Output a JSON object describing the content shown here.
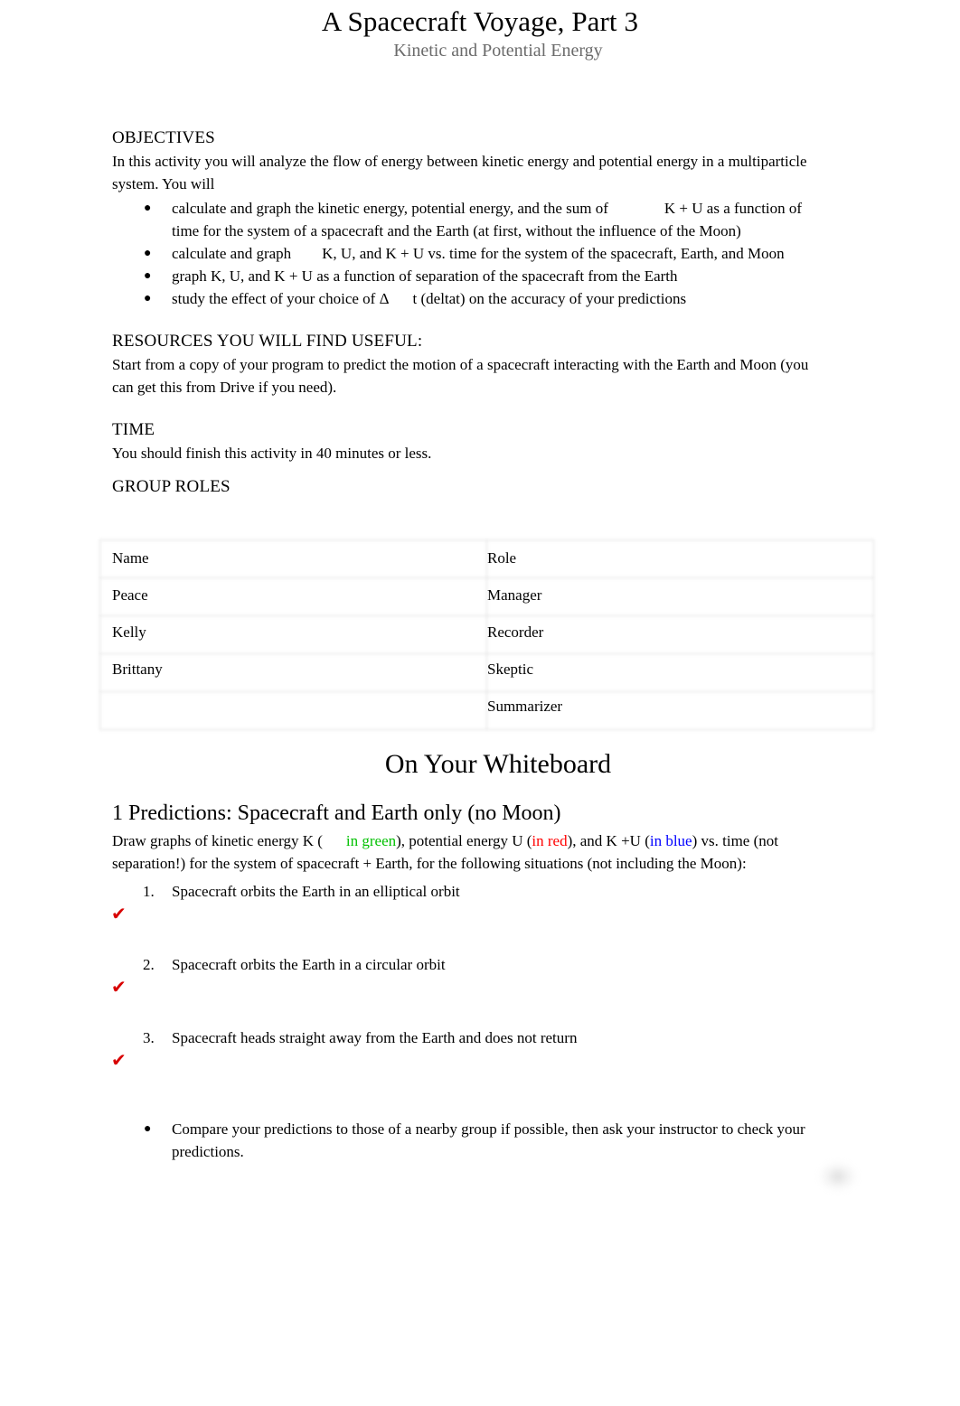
{
  "document": {
    "title": "A Spacecraft Voyage, Part 3",
    "subtitle": "Kinetic and Potential Energy"
  },
  "objectives": {
    "heading": "OBJECTIVES",
    "intro": "In this activity you will analyze the flow of energy between kinetic energy and potential energy in a multiparticle system. You will",
    "items": [
      {
        "part1": "calculate and graph the kinetic energy, potential energy, and the sum of",
        "part2": "K + U as a function of time for the system of a spacecraft and the Earth (at first, without the influence of the Moon)"
      },
      {
        "part1": "calculate and graph",
        "part2": "K, U, and  K + U vs. time for the system of the spacecraft, Earth, and Moon"
      },
      {
        "part1": "graph  K, U, and  K + U as a function of separation of the spacecraft from the Earth",
        "part2": ""
      },
      {
        "part1": "study the effect of your choice of Δ",
        "part2": "t (deltat) on the accuracy of your predictions"
      }
    ]
  },
  "resources": {
    "heading": "RESOURCES YOU WILL FIND USEFUL:",
    "text": "Start from a copy of your program to predict the motion of a spacecraft interacting with the Earth and Moon (you can get this from Drive if you need)."
  },
  "time": {
    "heading": "TIME",
    "text": "You should finish this activity in 40 minutes or less."
  },
  "group_roles": {
    "heading": "GROUP ROLES",
    "columns": [
      "Name",
      "Role"
    ],
    "rows": [
      {
        "name": "Peace",
        "role": "Manager"
      },
      {
        "name": "Kelly",
        "role": "Recorder"
      },
      {
        "name": "Brittany",
        "role": "Skeptic"
      },
      {
        "name": "",
        "role": "Summarizer"
      }
    ]
  },
  "whiteboard": {
    "heading": "On Your Whiteboard",
    "section_heading": "1 Predictions: Spacecraft and Earth only (no Moon)",
    "intro": {
      "seg1": "Draw graphs of kinetic energy K (",
      "green": "in green",
      "seg2": "), potential energy U (",
      "red": "in red",
      "seg3": "), and K +U (",
      "blue": "in blue",
      "seg4": ") vs. time (not separation!) for the system of spacecraft + Earth, for the following situations (not including the Moon):"
    },
    "numbered": [
      {
        "num": "1.",
        "text": "Spacecraft orbits the Earth in an elliptical orbit"
      },
      {
        "num": "2.",
        "text": "Spacecraft orbits the Earth in a circular orbit"
      },
      {
        "num": "3.",
        "text": "Spacecraft heads straight away from the Earth and does not return"
      }
    ],
    "check_glyph": "✔",
    "final_bullet": "Compare your predictions to those of a nearby group if possible, then ask your instructor to check your predictions."
  },
  "colors": {
    "green": "#00c000",
    "red": "#ff0000",
    "blue": "#0000ff",
    "check_red": "#d80000",
    "subtitle_gray": "#6b6b6b",
    "table_border": "#dcdcdc"
  },
  "glyphs": {
    "bullet": "●"
  }
}
